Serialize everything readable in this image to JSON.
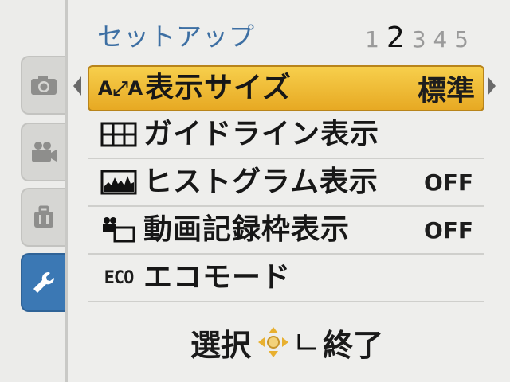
{
  "header": {
    "title": "セットアップ",
    "pages": [
      "1",
      "2",
      "3",
      "4",
      "5"
    ],
    "current_page": "2"
  },
  "tabs": [
    {
      "icon": "camera-icon",
      "active": false
    },
    {
      "icon": "movie-camera-icon",
      "active": false
    },
    {
      "icon": "bag-icon",
      "active": false
    },
    {
      "icon": "wrench-icon",
      "active": true
    }
  ],
  "menu": {
    "items": [
      {
        "icon": "font-size-icon",
        "icon_text": "A⤢A",
        "label": "表示サイズ",
        "value": "標準",
        "selected": true
      },
      {
        "icon": "grid-icon",
        "label": "ガイドライン表示",
        "value": ""
      },
      {
        "icon": "histogram-icon",
        "label": "ヒストグラム表示",
        "value": "OFF"
      },
      {
        "icon": "movie-frame-icon",
        "label": "動画記録枠表示",
        "value": "OFF"
      },
      {
        "icon": "eco-icon",
        "icon_text": "ECO",
        "label": "エコモード",
        "value": ""
      }
    ]
  },
  "footer": {
    "select_label": "選択",
    "exit_label": "終了"
  },
  "colors": {
    "title": "#3d6fa3",
    "highlight": "#f2be3a",
    "active_tab": "#3b78b4"
  }
}
